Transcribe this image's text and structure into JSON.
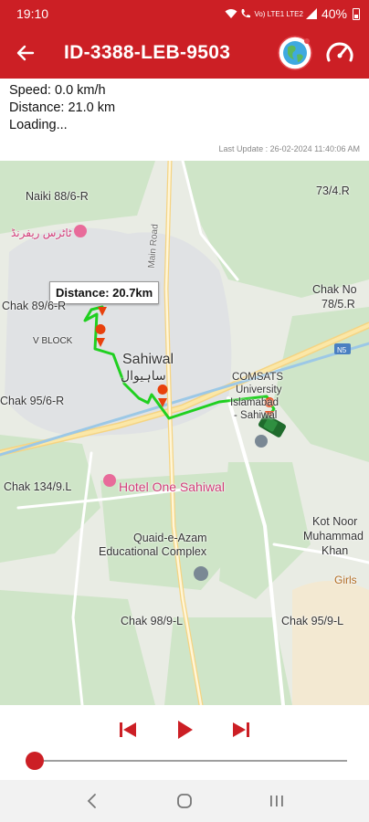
{
  "status_bar": {
    "time": "19:10",
    "indicators": "Vo) LTE1 LTE2",
    "battery": "40%"
  },
  "app_bar": {
    "title": "ID-3388-LEB-9503",
    "back_icon": "arrow-left-icon",
    "globe_icon": "globe-icon",
    "speedometer_icon": "speedometer-icon"
  },
  "info": {
    "speed": "Speed: 0.0 km/h",
    "distance": "Distance: 21.0 km",
    "status": "Loading...",
    "last_update": "Last Update : 26-02-2024 11:40:06 AM"
  },
  "map": {
    "distance_label": "Distance: 20.7km",
    "place_labels": [
      "Naiki 88/6-R",
      "ٹاٹرس ریفرنڈ",
      "73/4.R",
      "Chak 89/6-R",
      "V BLOCK",
      "Sahiwal",
      "ساہیوال",
      "COMSATS",
      "University",
      "Islamabad",
      "- Sahiwal",
      "Chak No",
      "78/5.R",
      "Chak 95/6-R",
      "Chak 134/9.L",
      "Hotel One Sahiwal",
      "Quaid-e-Azam",
      "Educational Complex",
      "Kot Noor",
      "Muhammad",
      "Khan",
      "Chak 98/9-L",
      "Chak 95/9-L",
      "N5",
      "Girls",
      "Main Road"
    ],
    "colors": {
      "route": "#20d020",
      "pin": "#e8410c",
      "vehicle": "#1f6b2c"
    }
  },
  "controls": {
    "rewind_icon": "skip-back-icon",
    "play_icon": "play-icon",
    "forward_icon": "skip-forward-icon",
    "progress": 0,
    "accent": "#cc1f25"
  },
  "nav_bar": {
    "back_icon": "nav-back-icon",
    "home_icon": "nav-home-icon",
    "recents_icon": "nav-recents-icon"
  }
}
